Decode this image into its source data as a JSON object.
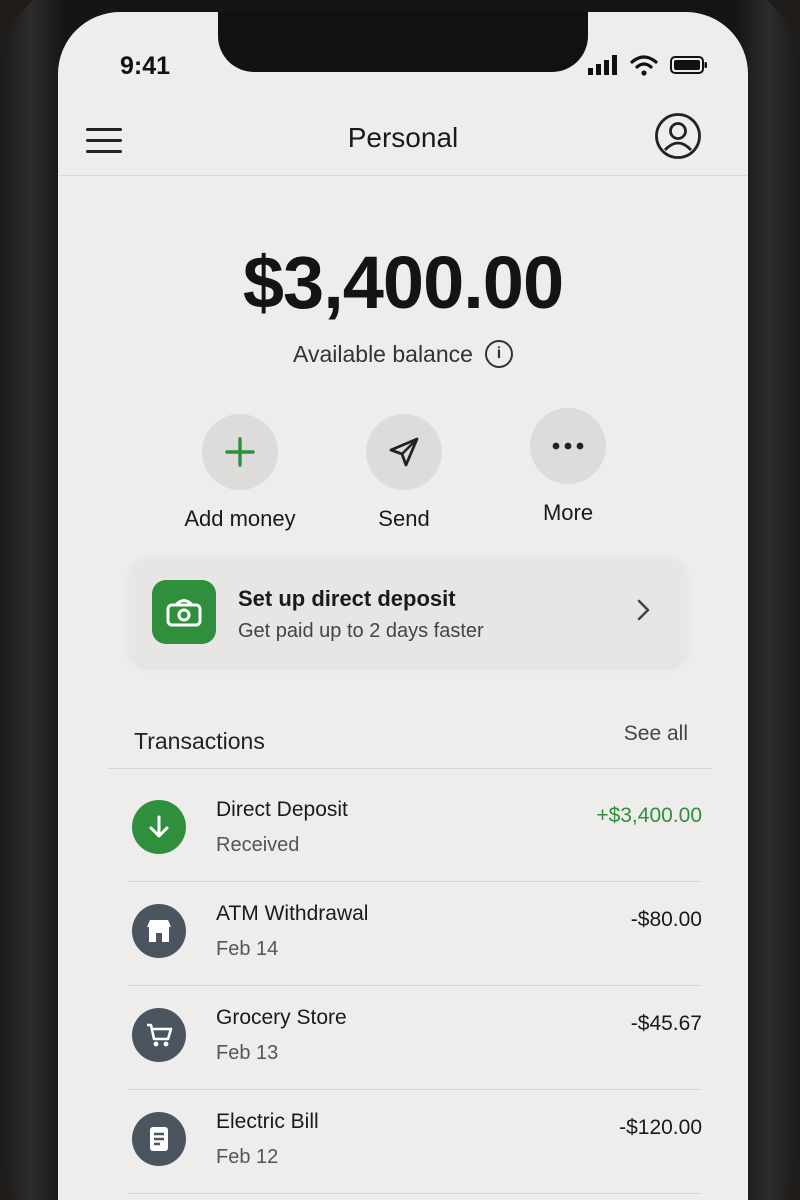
{
  "status": {
    "time": "9:41"
  },
  "header": {
    "title": "Personal"
  },
  "balance": {
    "amount": "$3,400.00",
    "label": "Available balance"
  },
  "actions": [
    {
      "label": "Add money",
      "icon": "plus-icon"
    },
    {
      "label": "Send",
      "icon": "send-icon"
    },
    {
      "label": "More",
      "icon": "more-icon"
    }
  ],
  "promo": {
    "title": "Set up direct deposit",
    "subtitle": "Get paid up to 2 days faster",
    "icon": "cash-icon"
  },
  "transactions": {
    "heading": "Transactions",
    "see_all": "See all",
    "items": [
      {
        "title": "Direct Deposit",
        "subtitle": "Received",
        "amount": "+$3,400.00",
        "icon": "arrow-down-icon"
      },
      {
        "title": "ATM Withdrawal",
        "subtitle": "Feb 14",
        "amount": "-$80.00",
        "icon": "store-icon"
      },
      {
        "title": "Grocery Store",
        "subtitle": "Feb 13",
        "amount": "-$45.67",
        "icon": "cart-icon"
      },
      {
        "title": "Electric Bill",
        "subtitle": "Feb 12",
        "amount": "-$120.00",
        "icon": "document-icon"
      }
    ]
  },
  "colors": {
    "accent": "#2f8f3c",
    "icon_bg": "#4a5560",
    "screen_bg": "#efedec"
  }
}
